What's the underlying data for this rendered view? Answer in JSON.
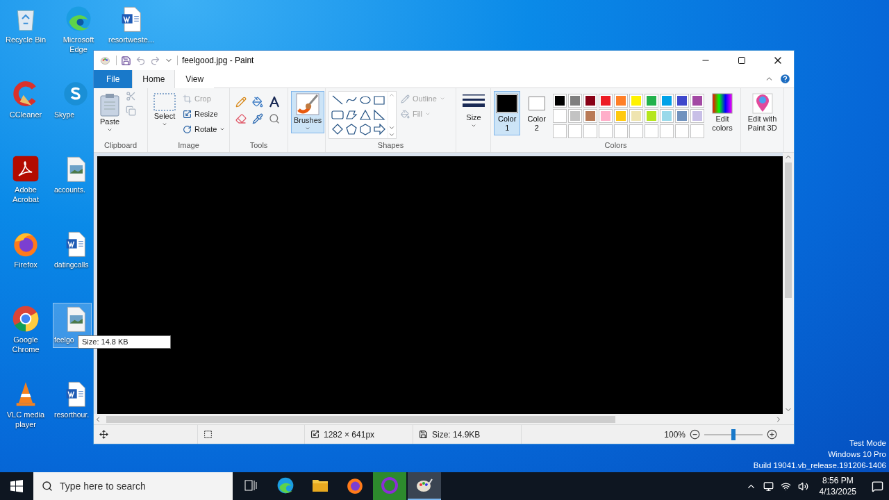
{
  "desktop_icons": [
    {
      "label": "Recycle Bin",
      "kind": "recycle",
      "selected": false
    },
    {
      "label": "CCleaner",
      "kind": "ccleaner",
      "selected": false
    },
    {
      "label": "Adobe Acrobat",
      "kind": "acrobat",
      "selected": false
    },
    {
      "label": "Firefox",
      "kind": "firefox",
      "selected": false
    },
    {
      "label": "Google Chrome",
      "kind": "chrome",
      "selected": false
    },
    {
      "label": "VLC media player",
      "kind": "vlc",
      "selected": false
    },
    {
      "label": "Microsoft Edge",
      "kind": "edge",
      "selected": false
    },
    {
      "label": "Skype",
      "kind": "skype",
      "selected": false
    },
    {
      "label": "accounts.",
      "kind": "image",
      "selected": false
    },
    {
      "label": "datingcalls",
      "kind": "word",
      "selected": false
    },
    {
      "label": "feelgo",
      "kind": "image",
      "selected": true,
      "tooltip": "Size: 14.8 KB"
    },
    {
      "label": "resorthour.",
      "kind": "word",
      "selected": false
    },
    {
      "label": "resortweste...",
      "kind": "word",
      "selected": false
    }
  ],
  "paint": {
    "title": "feelgood.jpg - Paint",
    "tabs": [
      {
        "label": "File",
        "kind": "file",
        "selected": false
      },
      {
        "label": "Home",
        "kind": "tab",
        "selected": true
      },
      {
        "label": "View",
        "kind": "tab",
        "selected": false
      }
    ],
    "ribbon": {
      "clipboard": {
        "label": "Clipboard",
        "paste": "Paste",
        "cut_disabled": true,
        "copy_disabled": true
      },
      "image": {
        "label": "Image",
        "select": "Select",
        "crop": {
          "label": "Crop",
          "disabled": true
        },
        "resize": {
          "label": "Resize",
          "disabled": false
        },
        "rotate": {
          "label": "Rotate",
          "disabled": false
        }
      },
      "tools": {
        "label": "Tools"
      },
      "brushes": {
        "label": "Brushes",
        "selected": true
      },
      "shapes": {
        "label": "Shapes",
        "outline": {
          "label": "Outline",
          "disabled": true
        },
        "fill": {
          "label": "Fill",
          "disabled": true
        }
      },
      "size": {
        "label": "Size"
      },
      "colors": {
        "label": "Colors",
        "color1": {
          "label": "Color 1",
          "color": "#000000",
          "selected": true
        },
        "color2": {
          "label": "Color 2",
          "color": "#ffffff",
          "selected": false
        },
        "palette": [
          {
            "color": "#000000"
          },
          {
            "color": "#7f7f7f"
          },
          {
            "color": "#880015"
          },
          {
            "color": "#ed1c24"
          },
          {
            "color": "#ff7f27"
          },
          {
            "color": "#fff200"
          },
          {
            "color": "#22b14c"
          },
          {
            "color": "#00a2e8"
          },
          {
            "color": "#3f48cc"
          },
          {
            "color": "#a349a4"
          },
          {
            "color": "#ffffff"
          },
          {
            "color": "#c3c3c3"
          },
          {
            "color": "#b97a57"
          },
          {
            "color": "#ffaec9"
          },
          {
            "color": "#ffc90e"
          },
          {
            "color": "#efe4b0"
          },
          {
            "color": "#b5e61d"
          },
          {
            "color": "#99d9ea"
          },
          {
            "color": "#7092be"
          },
          {
            "color": "#c8bfe7"
          }
        ],
        "edit": "Edit colors"
      },
      "paint3d": "Edit with Paint 3D"
    },
    "status": {
      "dimensions": "1282 × 641px",
      "size": "Size: 14.9KB",
      "zoom": "100%",
      "zoom_slider": {
        "level": 0.5
      }
    }
  },
  "system_notice": [
    "Test Mode",
    "Windows 10 Pro",
    "Build 19041.vb_release.191206-1406"
  ],
  "taskbar": {
    "search": {
      "placeholder": "Type here to search"
    },
    "apps": [
      {
        "kind": "taskview",
        "active": false,
        "attention": false
      },
      {
        "kind": "edge",
        "active": false,
        "attention": false
      },
      {
        "kind": "explorer",
        "active": false,
        "attention": false
      },
      {
        "kind": "firefox",
        "active": false,
        "attention": false
      },
      {
        "kind": "ring",
        "active": false,
        "attention": true
      },
      {
        "kind": "paint",
        "active": true,
        "attention": false
      }
    ],
    "time": "8:56 PM",
    "date": "4/13/2025"
  }
}
